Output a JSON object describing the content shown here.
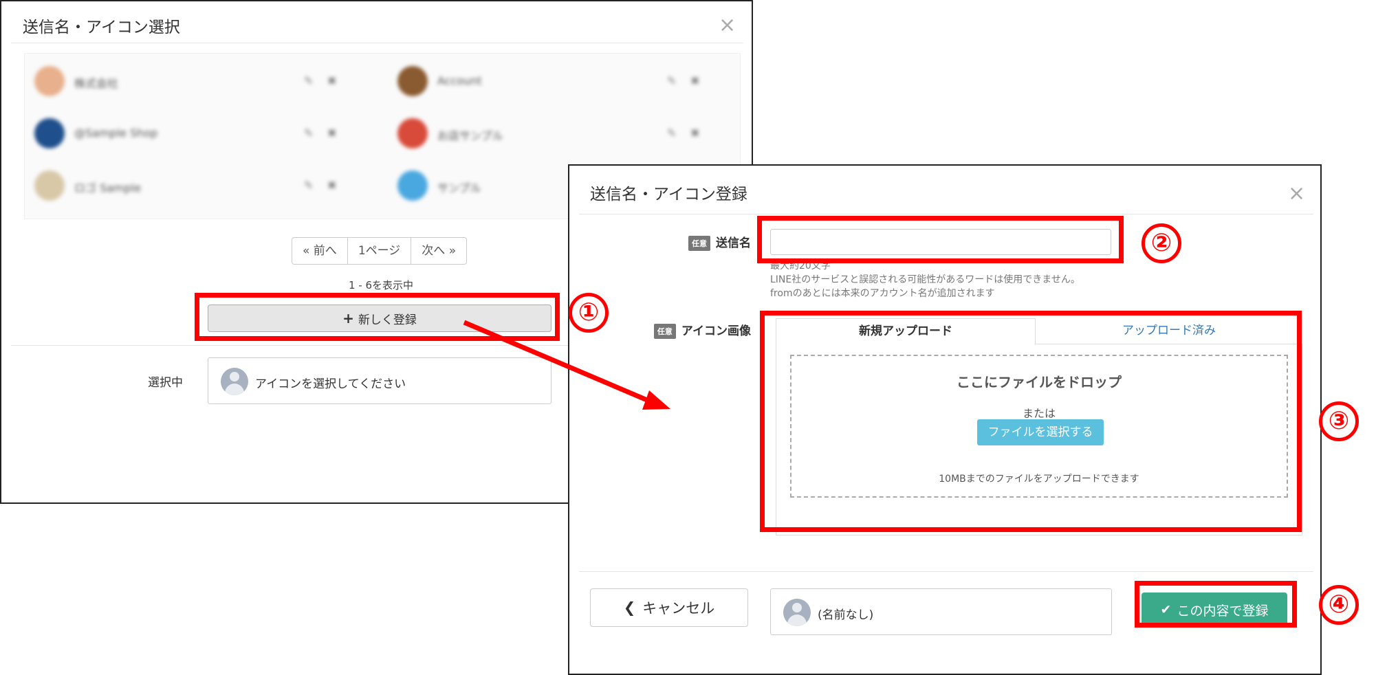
{
  "dialog_select": {
    "title": "送信名・アイコン選択",
    "close_icon": "×",
    "accounts": [
      {
        "name": "株式会社",
        "avatar_color": "#e8b08c"
      },
      {
        "name": "Account",
        "avatar_color": "#8a5a30"
      },
      {
        "name": "@Sample Shop",
        "avatar_color": "#1f4f8c"
      },
      {
        "name": "お店サンプル",
        "avatar_color": "#d84a3a"
      },
      {
        "name": "ロゴ Sample",
        "avatar_color": "#d8c8a8"
      },
      {
        "name": "サンプル",
        "avatar_color": "#4aa8e0"
      }
    ],
    "pager": {
      "prev": "« 前へ",
      "page": "1ページ",
      "next": "次へ »"
    },
    "count_text": "1 - 6を表示中",
    "new_button": {
      "icon": "+",
      "label": "新しく登録"
    },
    "selected_label": "選択中",
    "selected_placeholder": "アイコンを選択してください"
  },
  "dialog_register": {
    "title": "送信名・アイコン登録",
    "close_icon": "×",
    "badge": "任意",
    "sender_name_label": "送信名",
    "sender_name_value": "",
    "help_lines": [
      "最大約20文字",
      "LINE社のサービスと誤認される可能性があるワードは使用できません。",
      "fromのあとには本来のアカウント名が追加されます"
    ],
    "icon_image_label": "アイコン画像",
    "tabs": {
      "new_upload": "新規アップロード",
      "uploaded": "アップロード済み"
    },
    "dropzone": {
      "title": "ここにファイルをドロップ",
      "or": "または",
      "button": "ファイルを選択する",
      "note": "10MBまでのファイルをアップロードできます"
    },
    "cancel_button": {
      "icon": "chevron-left",
      "label": "キャンセル"
    },
    "preview_name": "(名前なし)",
    "submit_button": {
      "icon": "✔",
      "label": "この内容で登録"
    }
  },
  "annotations": {
    "color": "#ff0000",
    "numbers": [
      "①",
      "②",
      "③",
      "④"
    ]
  }
}
